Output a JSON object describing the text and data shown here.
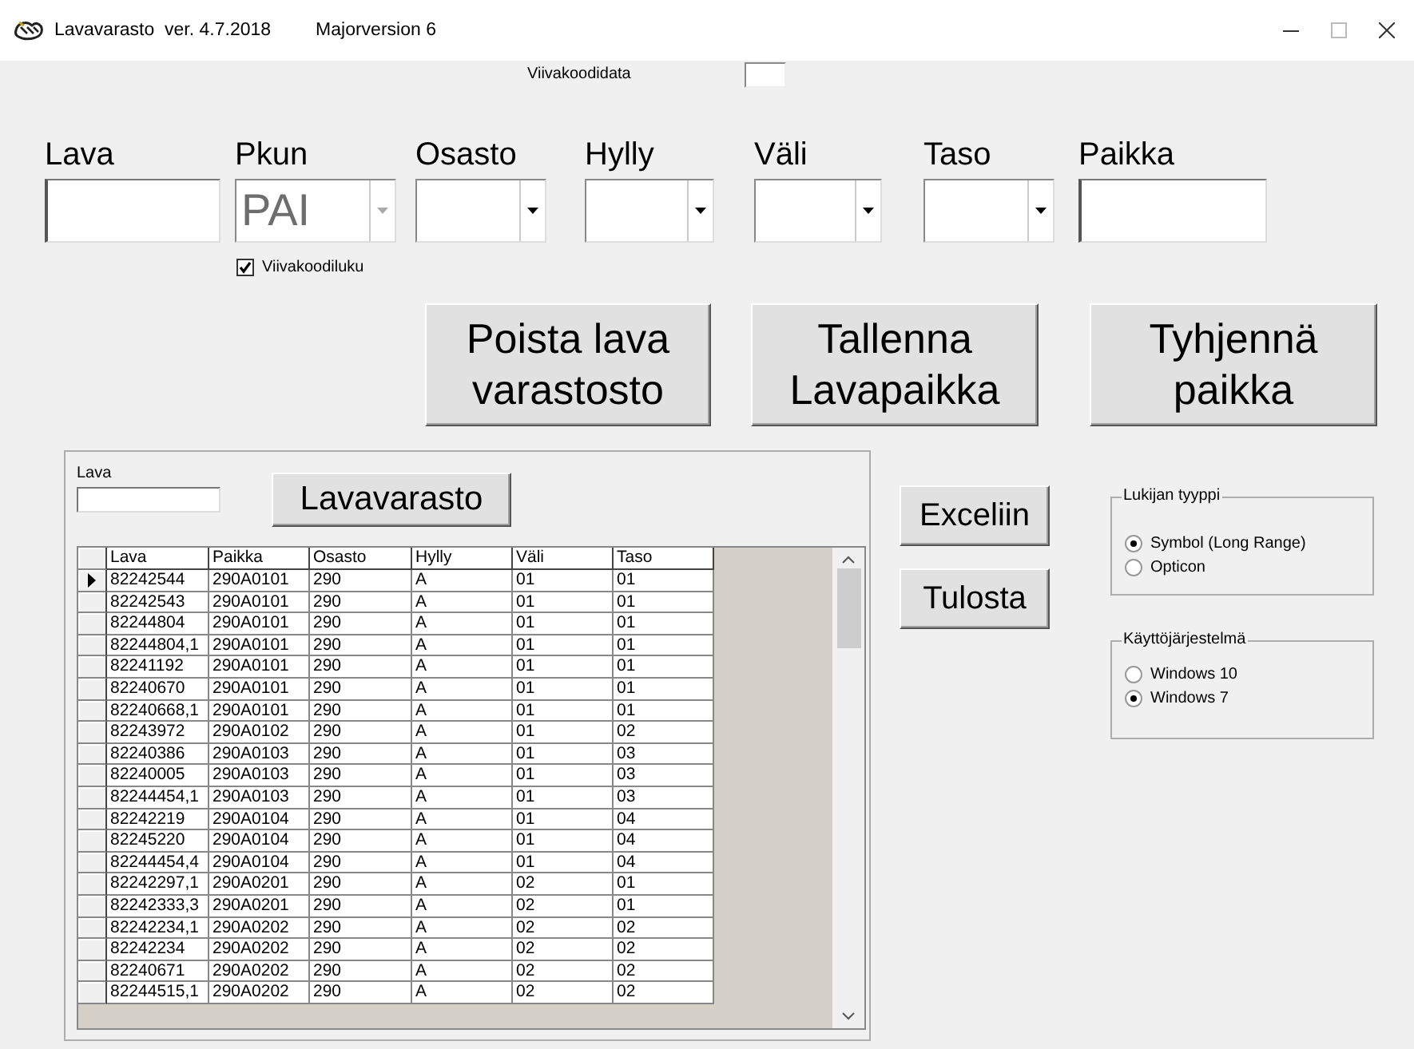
{
  "window": {
    "title": "Lavavarasto  ver. 4.7.2018",
    "subtitle": "Majorversion 6"
  },
  "barcode_data": {
    "label": "Viivakoodidata"
  },
  "fields": [
    {
      "label": "Lava",
      "kind": "text",
      "disabled": false
    },
    {
      "label": "Pkun",
      "kind": "combo",
      "value": "PAI",
      "disabled": true
    },
    {
      "label": "Osasto",
      "kind": "combo",
      "disabled": false
    },
    {
      "label": "Hylly",
      "kind": "combo",
      "disabled": false
    },
    {
      "label": "Väli",
      "kind": "combo",
      "disabled": false
    },
    {
      "label": "Taso",
      "kind": "combo",
      "disabled": false
    },
    {
      "label": "Paikka",
      "kind": "text",
      "disabled": false
    }
  ],
  "barcode_read": {
    "label": "Viivakoodiluku",
    "checked": true
  },
  "actions": [
    {
      "lines": [
        "Poista lava",
        "varastosto"
      ]
    },
    {
      "lines": [
        "Tallenna",
        "Lavapaikka"
      ]
    },
    {
      "lines": [
        "Tyhjennä",
        "paikka"
      ]
    }
  ],
  "panel": {
    "filter_label": "Lava",
    "button": "Lavavarasto",
    "table": {
      "columns": [
        "Lava",
        "Paikka",
        "Osasto",
        "Hylly",
        "Väli",
        "Taso"
      ],
      "rows": [
        {
          "cells": [
            "82242544",
            "290A0101",
            "290",
            "A",
            "01",
            "01"
          ],
          "selected": true
        },
        {
          "cells": [
            "82242543",
            "290A0101",
            "290",
            "A",
            "01",
            "01"
          ],
          "selected": false
        },
        {
          "cells": [
            "82244804",
            "290A0101",
            "290",
            "A",
            "01",
            "01"
          ],
          "selected": false
        },
        {
          "cells": [
            "82244804,1",
            "290A0101",
            "290",
            "A",
            "01",
            "01"
          ],
          "selected": false
        },
        {
          "cells": [
            "82241192",
            "290A0101",
            "290",
            "A",
            "01",
            "01"
          ],
          "selected": false
        },
        {
          "cells": [
            "82240670",
            "290A0101",
            "290",
            "A",
            "01",
            "01"
          ],
          "selected": false
        },
        {
          "cells": [
            "82240668,1",
            "290A0101",
            "290",
            "A",
            "01",
            "01"
          ],
          "selected": false
        },
        {
          "cells": [
            "82243972",
            "290A0102",
            "290",
            "A",
            "01",
            "02"
          ],
          "selected": false
        },
        {
          "cells": [
            "82240386",
            "290A0103",
            "290",
            "A",
            "01",
            "03"
          ],
          "selected": false
        },
        {
          "cells": [
            "82240005",
            "290A0103",
            "290",
            "A",
            "01",
            "03"
          ],
          "selected": false
        },
        {
          "cells": [
            "82244454,1",
            "290A0103",
            "290",
            "A",
            "01",
            "03"
          ],
          "selected": false
        },
        {
          "cells": [
            "82242219",
            "290A0104",
            "290",
            "A",
            "01",
            "04"
          ],
          "selected": false
        },
        {
          "cells": [
            "82245220",
            "290A0104",
            "290",
            "A",
            "01",
            "04"
          ],
          "selected": false
        },
        {
          "cells": [
            "82244454,4",
            "290A0104",
            "290",
            "A",
            "01",
            "04"
          ],
          "selected": false
        },
        {
          "cells": [
            "82242297,1",
            "290A0201",
            "290",
            "A",
            "02",
            "01"
          ],
          "selected": false
        },
        {
          "cells": [
            "82242333,3",
            "290A0201",
            "290",
            "A",
            "02",
            "01"
          ],
          "selected": false
        },
        {
          "cells": [
            "82242234,1",
            "290A0202",
            "290",
            "A",
            "02",
            "02"
          ],
          "selected": false
        },
        {
          "cells": [
            "82242234",
            "290A0202",
            "290",
            "A",
            "02",
            "02"
          ],
          "selected": false
        },
        {
          "cells": [
            "82240671",
            "290A0202",
            "290",
            "A",
            "02",
            "02"
          ],
          "selected": false
        },
        {
          "cells": [
            "82244515,1",
            "290A0202",
            "290",
            "A",
            "02",
            "02"
          ],
          "selected": false
        }
      ]
    }
  },
  "side_buttons": [
    "Exceliin",
    "Tulosta"
  ],
  "groups": [
    {
      "title": "Lukijan tyyppi",
      "options": [
        {
          "label": "Symbol (Long Range)",
          "selected": true
        },
        {
          "label": "Opticon",
          "selected": false
        }
      ]
    },
    {
      "title": "Käyttöjärjestelmä",
      "options": [
        {
          "label": "Windows 10",
          "selected": false
        },
        {
          "label": "Windows 7",
          "selected": true
        }
      ]
    }
  ]
}
